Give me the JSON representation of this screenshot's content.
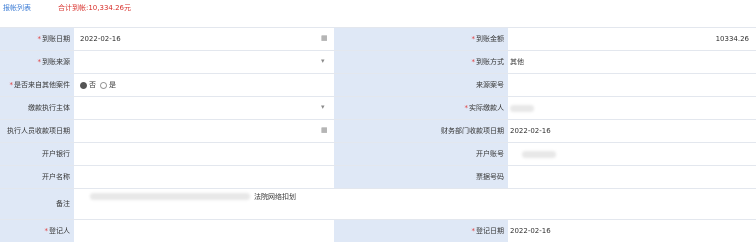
{
  "topbar": {
    "list_link": "报帐列表",
    "total": "合计到帐:10,334.26元"
  },
  "icons": {
    "calendar": "calendar-icon",
    "dropdown": "chevron-down-icon"
  },
  "fields": {
    "arrival_date": {
      "label": "到账日期",
      "value": "2022-02-16"
    },
    "arrival_amount": {
      "label": "到账金额",
      "value": "10334.26"
    },
    "arrival_source": {
      "label": "到账来源",
      "value": ""
    },
    "arrival_method": {
      "label": "到账方式",
      "value": "其他"
    },
    "from_other_case": {
      "label": "是否来自其他案件",
      "options": [
        "否",
        "是"
      ],
      "selected": "否"
    },
    "source_case_no": {
      "label": "来源案号",
      "value": ""
    },
    "collection_subject": {
      "label": "缴款执行主体",
      "value": ""
    },
    "actual_payer": {
      "label": "实际缴款人",
      "value": ""
    },
    "executor_receipt_date": {
      "label": "执行人员收款项日期",
      "value": ""
    },
    "finance_receipt_date": {
      "label": "财务部门收款项日期",
      "value": "2022-02-16"
    },
    "bank": {
      "label": "开户银行",
      "value": ""
    },
    "account_no": {
      "label": "开户账号",
      "value": ""
    },
    "account_name": {
      "label": "开户名称",
      "value": ""
    },
    "bill_no": {
      "label": "票据号码",
      "value": ""
    },
    "remarks": {
      "label": "备注",
      "value": "法院网络扣划"
    },
    "registrant": {
      "label": "登记人",
      "value": ""
    },
    "register_date": {
      "label": "登记日期",
      "value": "2022-02-16"
    }
  }
}
